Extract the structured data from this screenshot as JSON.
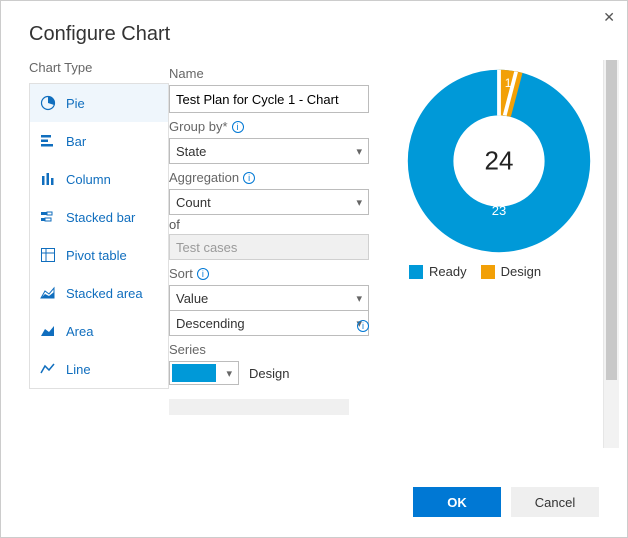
{
  "dialog": {
    "title": "Configure Chart",
    "ok": "OK",
    "cancel": "Cancel"
  },
  "left": {
    "label": "Chart Type",
    "types": {
      "pie": "Pie",
      "bar": "Bar",
      "column": "Column",
      "stacked_bar": "Stacked bar",
      "pivot_table": "Pivot table",
      "stacked_area": "Stacked area",
      "area": "Area",
      "line": "Line"
    },
    "selected": "pie"
  },
  "fields": {
    "name_label": "Name",
    "name_value": "Test Plan for Cycle 1 - Chart",
    "group_by_label": "Group by*",
    "group_by_value": "State",
    "aggregation_label": "Aggregation",
    "aggregation_value": "Count",
    "of_label": "of",
    "of_value_placeholder": "Test cases",
    "sort_label": "Sort",
    "sort_field_value": "Value",
    "sort_dir_value": "Descending",
    "series_label": "Series",
    "series_value_label": "Design",
    "series_color": "#0099d8"
  },
  "chart_preview": {
    "total": "24",
    "slice_ready_label": "23",
    "slice_design_label": "1",
    "legend_ready": "Ready",
    "legend_design": "Design",
    "color_ready": "#0099d8",
    "color_design": "#f2a007",
    "color_center_bg": "#ffffff"
  },
  "chart_data": {
    "type": "pie",
    "title": "",
    "categories": [
      "Ready",
      "Design"
    ],
    "values": [
      23,
      1
    ],
    "total": 24,
    "colors": {
      "Ready": "#0099d8",
      "Design": "#f2a007"
    },
    "donut": true,
    "legend_position": "bottom"
  }
}
